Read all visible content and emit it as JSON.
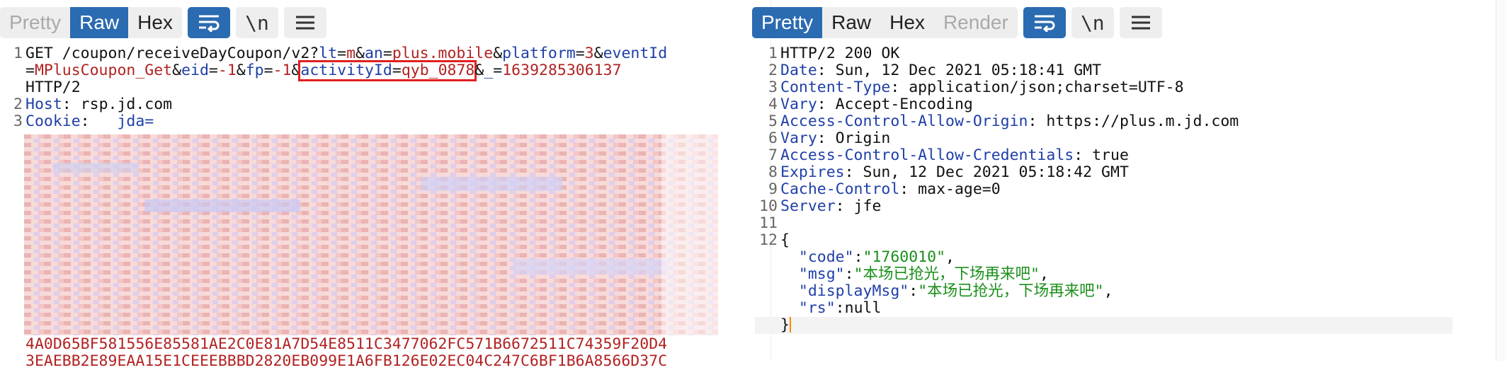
{
  "colors": {
    "accent": "#2b6bb1",
    "key": "#1f3fa8",
    "value": "#b22222",
    "string": "#1a8f1a",
    "highlight_box": "#e02020",
    "caret": "#ff8a00"
  },
  "request": {
    "tabs": [
      "Pretty",
      "Raw",
      "Hex"
    ],
    "active_tab": "Raw",
    "icons": [
      "wrap-icon",
      "newline-icon",
      "menu-icon"
    ],
    "newline_label": "\\n",
    "line1": {
      "method": "GET /coupon/receiveDayCoupon/v2?",
      "p1k": "lt",
      "p1v": "m",
      "p2k": "an",
      "p2v": "plus.mobile",
      "p3k": "platform",
      "p3v": "3",
      "p4k": "eventId"
    },
    "line1b": {
      "p4v": "MPlusCoupon_Get",
      "p5k": "eid",
      "p5v": "-1",
      "p6k": "fp",
      "p6v": "-1",
      "p7k": "activityId",
      "p7v": "qyb_0878",
      "p8k": "_",
      "p8v": "1639285306137"
    },
    "line1c": "HTTP/2",
    "host_key": "Host",
    "host_val": " rsp.jd.com",
    "cookie_key": "Cookie",
    "cookie_val": "   jda=",
    "cookie_tail1": "4A0D65BF581556E85581AE2C0E81A7D54E8511C3477062FC571B6672511C74359F20D4",
    "cookie_tail2": "3EAEBB2E89EAA15E1CEEEBBBD2820EB099E1A6FB126E02EC04C247C6BF1B6A8566D37C",
    "line_numbers": [
      "1",
      "2",
      "3"
    ]
  },
  "response": {
    "tabs": [
      "Pretty",
      "Raw",
      "Hex",
      "Render"
    ],
    "active_tab": "Pretty",
    "icons": [
      "wrap-icon",
      "newline-icon",
      "menu-icon"
    ],
    "newline_label": "\\n",
    "status": "HTTP/2 200 OK",
    "headers": [
      {
        "ln": "2",
        "k": "Date",
        "v": " Sun, 12 Dec 2021 05:18:41 GMT"
      },
      {
        "ln": "3",
        "k": "Content-Type",
        "v": " application/json;charset=UTF-8"
      },
      {
        "ln": "4",
        "k": "Vary",
        "v": " Accept-Encoding"
      },
      {
        "ln": "5",
        "k": "Access-Control-Allow-Origin",
        "v": " https://plus.m.jd.com"
      },
      {
        "ln": "6",
        "k": "Vary",
        "v": " Origin"
      },
      {
        "ln": "7",
        "k": "Access-Control-Allow-Credentials",
        "v": " true"
      },
      {
        "ln": "8",
        "k": "Expires",
        "v": " Sun, 12 Dec 2021 05:18:42 GMT"
      },
      {
        "ln": "9",
        "k": "Cache-Control",
        "v": " max-age=0"
      },
      {
        "ln": "10",
        "k": "Server",
        "v": " jfe"
      }
    ],
    "blank_ln": "11",
    "body_ln": "12",
    "json": {
      "open": "{",
      "k1": "\"code\"",
      "v1": "\"1760010\"",
      "k2": "\"msg\"",
      "v2": "\"本场已抢光，下场再来吧\"",
      "k3": "\"displayMsg\"",
      "v3": "\"本场已抢光，下场再来吧\"",
      "k4": "\"rs\"",
      "v4": "null",
      "close": "}"
    }
  }
}
